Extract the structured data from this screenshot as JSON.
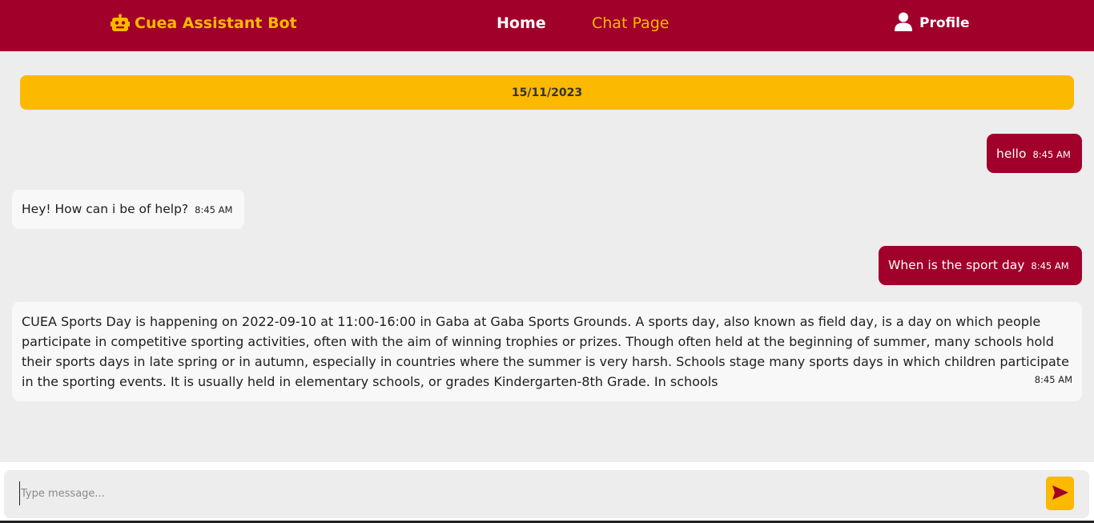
{
  "colors": {
    "primary": "#a0002a",
    "accent": "#fbb900",
    "background": "#ededed"
  },
  "navbar": {
    "brand": {
      "icon": "robot-icon",
      "label": "Cuea Assistant Bot"
    },
    "links": [
      {
        "label": "Home"
      },
      {
        "label": "Chat Page"
      }
    ],
    "profile": {
      "icon": "user-icon",
      "label": "Profile"
    }
  },
  "chat": {
    "date": "15/11/2023",
    "messages": [
      {
        "sender": "user",
        "text": "hello",
        "time": "8:45 AM"
      },
      {
        "sender": "bot",
        "text": "Hey! How can i be of help?",
        "time": "8:45 AM"
      },
      {
        "sender": "user",
        "text": "When is the sport day",
        "time": "8:45 AM"
      },
      {
        "sender": "bot",
        "text": "CUEA Sports Day is happening on 2022-09-10 at 11:00-16:00 in Gaba at Gaba Sports Grounds. A sports day, also known as field day, is a day on which people participate in competitive sporting activities, often with the aim of winning trophies or prizes. Though often held at the beginning of summer, many schools hold their sports days in late spring or in autumn, especially in countries where the summer is very harsh. Schools stage many sports days in which children participate in the sporting events. It is usually held in elementary schools, or grades Kindergarten-8th Grade. In schools",
        "time": "8:45 AM"
      }
    ]
  },
  "composer": {
    "placeholder": "Type message...",
    "value": "",
    "send_icon": "send-icon"
  }
}
